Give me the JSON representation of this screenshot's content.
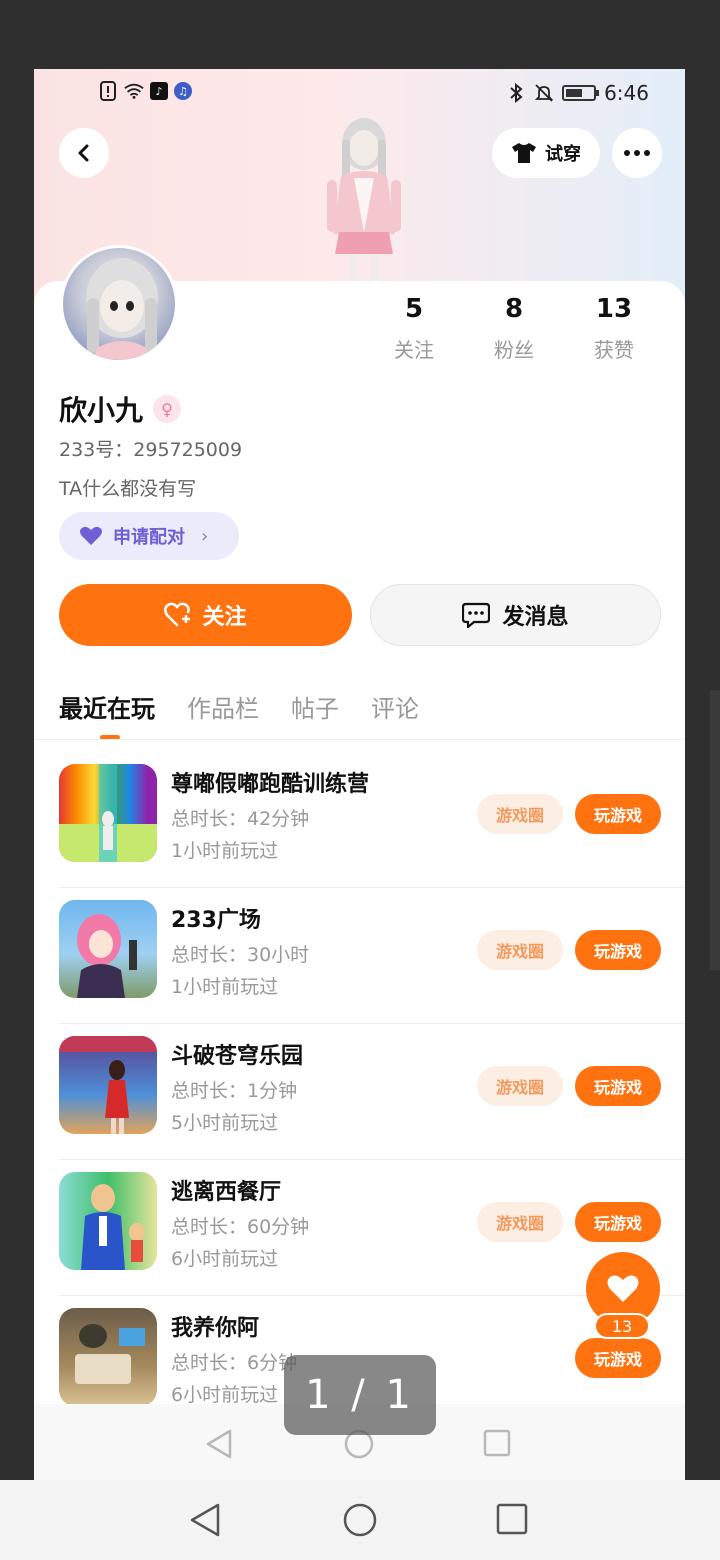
{
  "status_bar": {
    "time": "6:46",
    "left_icons": [
      "sim-alert-icon",
      "wifi-icon",
      "tiktok-icon",
      "music-icon"
    ],
    "right_icons": [
      "bluetooth-icon",
      "mute-icon",
      "battery-icon"
    ]
  },
  "header": {
    "try_on_label": "试穿"
  },
  "profile": {
    "name": "欣小九",
    "gender_symbol": "♀",
    "uid": "233号：295725009",
    "bio": "TA什么都没有写",
    "match_label": "申请配对",
    "match_chevron": "›",
    "stats": [
      {
        "value": "5",
        "label": "关注"
      },
      {
        "value": "8",
        "label": "粉丝"
      },
      {
        "value": "13",
        "label": "获赞"
      }
    ]
  },
  "actions": {
    "follow_label": "关注",
    "message_label": "发消息"
  },
  "tabs": [
    {
      "label": "最近在玩",
      "active": true
    },
    {
      "label": "作品栏",
      "active": false
    },
    {
      "label": "帖子",
      "active": false
    },
    {
      "label": "评论",
      "active": false
    }
  ],
  "games": [
    {
      "title": "尊嘟假嘟跑酷训练营",
      "duration": "总时长：42分钟",
      "last_played": "1小时前玩过",
      "circle_label": "游戏圈",
      "play_label": "玩游戏"
    },
    {
      "title": "233广场",
      "duration": "总时长：30小时",
      "last_played": "1小时前玩过",
      "circle_label": "游戏圈",
      "play_label": "玩游戏"
    },
    {
      "title": "斗破苍穹乐园",
      "duration": "总时长：1分钟",
      "last_played": "5小时前玩过",
      "circle_label": "游戏圈",
      "play_label": "玩游戏"
    },
    {
      "title": "逃离西餐厅",
      "duration": "总时长：60分钟",
      "last_played": "6小时前玩过",
      "circle_label": "游戏圈",
      "play_label": "玩游戏"
    },
    {
      "title": "我养你阿",
      "duration": "总时长：6分钟",
      "last_played": "6小时前玩过",
      "circle_label": "",
      "play_label": "玩游戏"
    }
  ],
  "like_float": {
    "count": "13"
  },
  "page_indicator": "1 / 1",
  "colors": {
    "accent": "#ff7210",
    "match_bg": "#ecebfb",
    "match_text": "#6d5fd6"
  }
}
